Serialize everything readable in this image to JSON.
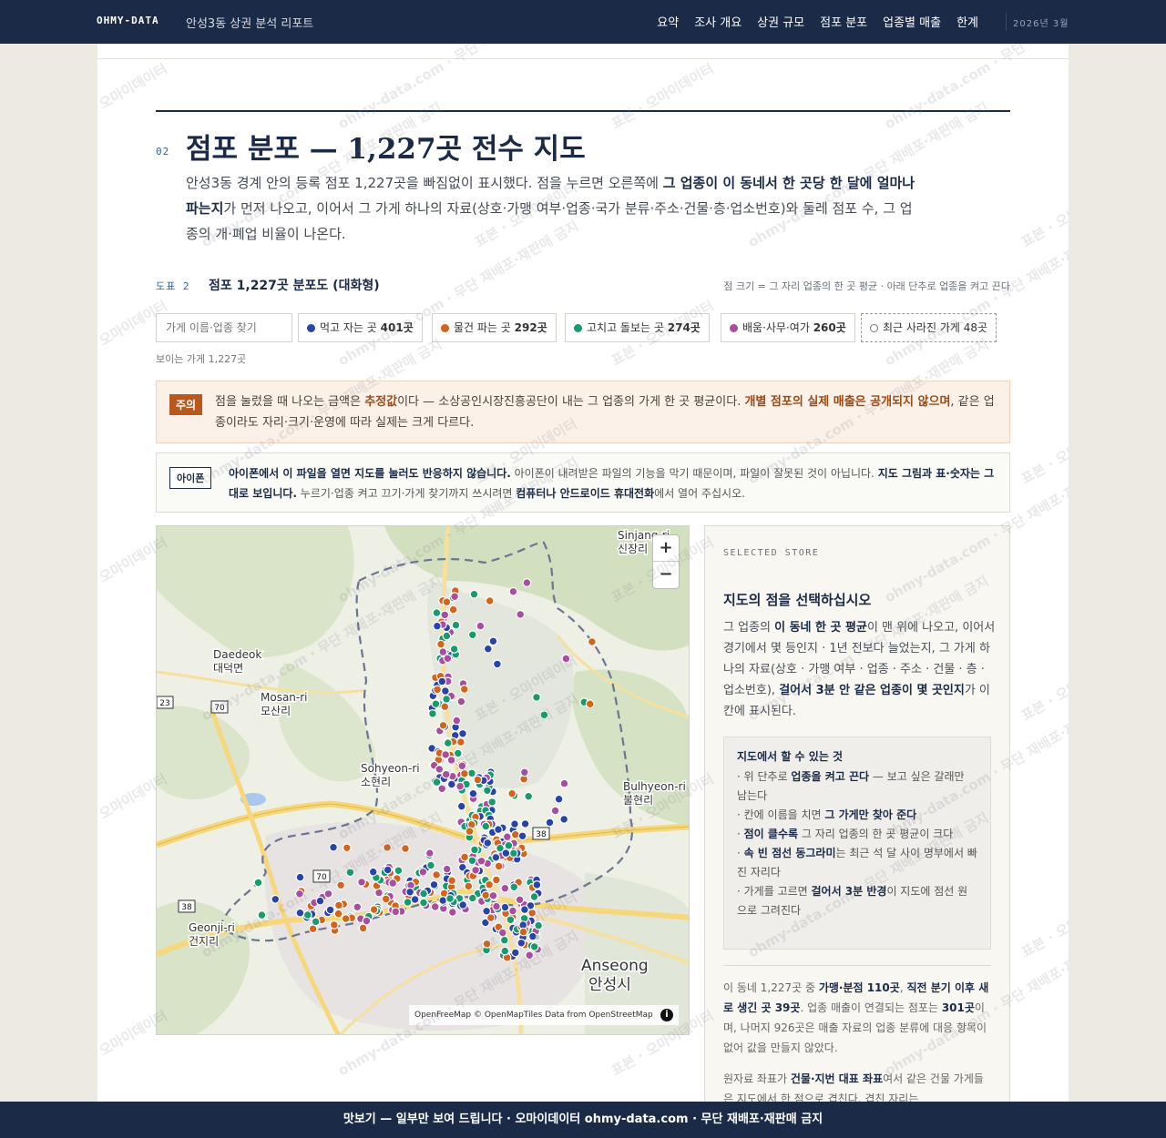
{
  "nav": {
    "brand": "OHMY-DATA",
    "report_title": "안성3동 상권 분석 리포트",
    "links": [
      "요약",
      "조사 개요",
      "상권 규모",
      "점포 분포",
      "업종별 매출",
      "한계"
    ],
    "date": "2026년 3월"
  },
  "section": {
    "number": "02",
    "title": "점포 분포 — 1,227곳 전수 지도",
    "lede_1": "안성3동 경계 안의 등록 점포 1,227곳을 빠짐없이 표시했다. 점을 누르면 오른쪽에 ",
    "lede_bold": "그 업종이 이 동네서 한 곳당 한 달에 얼마나 파는지",
    "lede_2": "가 먼저 나오고, 이어서 그 가게 하나의 자료(상호·가맹 여부·업종·국가 분류·주소·건물·층·업소번호)와 둘레 점포 수, 그 업종의 개·폐업 비율이 나온다."
  },
  "figure": {
    "label": "도표 2",
    "title": "점포 1,227곳 분포도 (대화형)",
    "note": "점 크기 = 그 자리 업종의 한 곳 평균 · 아래 단추로 업종을 켜고 끈다",
    "search_placeholder": "가게 이름·업종 찾기",
    "visible_count": "보이는 가게 1,227곳"
  },
  "filters": [
    {
      "label": "먹고 자는 곳",
      "count": "401곳",
      "color": "#2944a8"
    },
    {
      "label": "물건 파는 곳",
      "count": "292곳",
      "color": "#d2641c"
    },
    {
      "label": "고치고 돌보는 곳",
      "count": "274곳",
      "color": "#159b6c"
    },
    {
      "label": "배움·사무·여가",
      "count": "260곳",
      "color": "#a84da0"
    },
    {
      "label": "최근 사라진 가게",
      "count": "48곳",
      "color": "#777777"
    }
  ],
  "caution": {
    "badge": "주의",
    "t1": "점을 눌렀을 때 나오는 금액은 ",
    "b1": "추정값",
    "t2": "이다 — 소상공인시장진흥공단이 내는 그 업종의 가게 한 곳 평균이다. ",
    "b2": "개별 점포의 실제 매출은 공개되지 않으며",
    "t3": ", 같은 업종이라도 자리·크기·운영에 따라 실제는 크게 다르다."
  },
  "iphone": {
    "badge": "아이폰",
    "b1": "아이폰에서 이 파일을 열면 지도를 눌러도 반응하지 않습니다.",
    "t1": " 아이폰이 내려받은 파일의 기능을 막기 때문이며, 파일이 잘못된 것이 아닙니다. ",
    "b2": "지도 그림과 표·숫자는 그대로 보입니다.",
    "t2": " 누르기·업종 켜고 끄기·가게 찾기까지 쓰시려면 ",
    "b3": "컴퓨터나 안드로이드 휴대전화",
    "t3": "에서 열어 주십시오."
  },
  "map": {
    "places": [
      {
        "name": "Daedeok",
        "kr": "대덕면"
      },
      {
        "name": "Mosan-ri",
        "kr": "모산리"
      },
      {
        "name": "Sohyeon-ri",
        "kr": "소현리"
      },
      {
        "name": "Bulhyeon-ri",
        "kr": "불현리"
      },
      {
        "name": "Geonji-ri",
        "kr": "건지리"
      },
      {
        "name": "Sinjang-ri",
        "kr": "신장리"
      },
      {
        "name": "Anseong",
        "kr": "안성시"
      }
    ],
    "roads": [
      "70",
      "70",
      "38",
      "38",
      "23"
    ],
    "zoom_in": "+",
    "zoom_out": "−",
    "attribution": "OpenFreeMap © OpenMapTiles Data from OpenStreetMap",
    "info": "i"
  },
  "side": {
    "label": "SELECTED STORE",
    "title": "지도의 점을 선택하십시오",
    "d1": "그 업종의 ",
    "db1": "이 동네 한 곳 평균",
    "d2": "이 맨 위에 나오고, 이어서 경기에서 몇 등인지 · 1년 전보다 늘었는지, 그 가게 하나의 자료(상호 · 가맹 여부 · 업종 · 주소 · 건물 · 층 · 업소번호), ",
    "db2": "걸어서 3분 안 같은 업종이 몇 곳인지",
    "d3": "가 이 칸에 표시된다.",
    "howto_title": "지도에서 할 수 있는 것",
    "howto": [
      {
        "pre": "· 위 단추로 ",
        "b": "업종을 켜고 끈다",
        "post": " — 보고 싶은 갈래만 남는다"
      },
      {
        "pre": "· 칸에 이름을 치면 ",
        "b": "그 가게만 찾아 준다",
        "post": ""
      },
      {
        "pre": "· ",
        "b": "점이 클수록",
        "post": " 그 자리 업종의 한 곳 평균이 크다"
      },
      {
        "pre": "· ",
        "b": "속 빈 점선 동그라미",
        "post": "는 최근 석 달 사이 명부에서 빠진 자리다"
      },
      {
        "pre": "· 가게를 고르면 ",
        "b": "걸어서 3분 반경",
        "post": "이 지도에 점선 원으로 그려진다"
      }
    ],
    "s1": "이 동네 1,227곳 중 ",
    "sb1": "가맹·분점 110곳",
    "s2": ", ",
    "sb2": "직전 분기 이후 새로 생긴 곳 39곳",
    "s3": ". 업종 매출이 연결되는 점포는 ",
    "sb3": "301곳",
    "s4": "이며, 나머지 926곳은 매출 자료의 업종 분류에 대응 항목이 없어 값을 만들지 않았다.",
    "r1": "원자료 좌표가 ",
    "rb1": "건물·지번 대표 좌표",
    "r2": "여서 같은 건물 가게들은 지도에서 한 점으로 겹친다. 겹친 자리는"
  },
  "watermark": {
    "a": "표본 · 오마이데이터",
    "b": "ohmy-data.com · 무단 재배포·재판매 금지"
  },
  "footer": "맛보기 — 일부만 보여 드립니다 · 오마이데이터 ohmy-data.com · 무단 재배포·재판매 금지"
}
